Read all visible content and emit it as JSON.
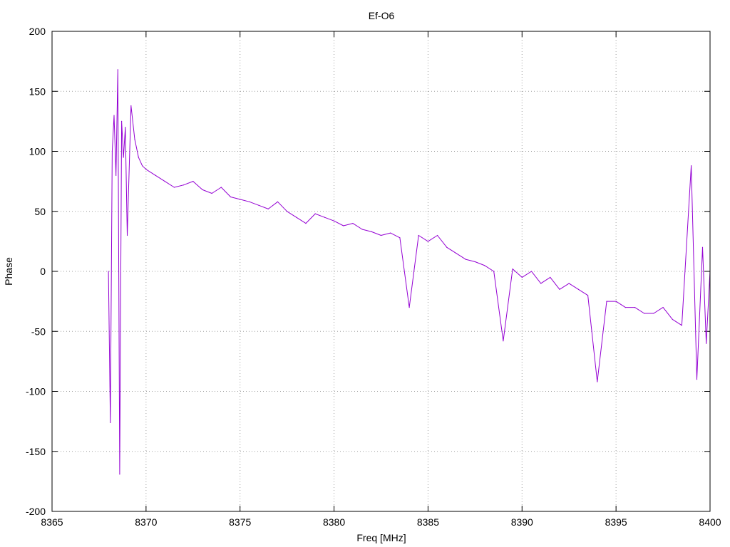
{
  "chart_data": {
    "type": "line",
    "title": "Ef-O6",
    "xlabel": "Freq [MHz]",
    "ylabel": "Phase",
    "xlim": [
      8365,
      8400
    ],
    "ylim": [
      -200,
      200
    ],
    "xticks": [
      8365,
      8370,
      8375,
      8380,
      8385,
      8390,
      8395,
      8400
    ],
    "yticks": [
      -200,
      -150,
      -100,
      -50,
      0,
      50,
      100,
      150,
      200
    ],
    "grid": true,
    "color": "#9400d3",
    "series": [
      {
        "x": [
          8368.0,
          8368.1,
          8368.2,
          8368.3,
          8368.4,
          8368.5,
          8368.6,
          8368.7,
          8368.8,
          8368.9,
          8369.0,
          8369.2,
          8369.4,
          8369.6,
          8369.8,
          8370.0,
          8370.5,
          8371.0,
          8371.5,
          8372.0,
          8372.5,
          8373.0,
          8373.5,
          8374.0,
          8374.5,
          8375.0,
          8375.5,
          8376.0,
          8376.5,
          8377.0,
          8377.5,
          8378.0,
          8378.5,
          8379.0,
          8379.5,
          8380.0,
          8380.5,
          8381.0,
          8381.5,
          8382.0,
          8382.5,
          8383.0,
          8383.5,
          8384.0,
          8384.5,
          8385.0,
          8385.5,
          8386.0,
          8386.5,
          8387.0,
          8387.5,
          8388.0,
          8388.5,
          8389.0,
          8389.5,
          8390.0,
          8390.5,
          8391.0,
          8391.5,
          8392.0,
          8392.5,
          8393.0,
          8393.5,
          8394.0,
          8394.5,
          8395.0,
          8395.5,
          8396.0,
          8396.5,
          8397.0,
          8397.5,
          8398.0,
          8398.5,
          8399.0,
          8399.3,
          8399.6,
          8399.8,
          8400.0
        ],
        "values": [
          0,
          -126,
          100,
          130,
          80,
          168,
          -169,
          125,
          95,
          120,
          30,
          138,
          110,
          95,
          88,
          85,
          80,
          75,
          70,
          72,
          75,
          68,
          65,
          70,
          62,
          60,
          58,
          55,
          52,
          58,
          50,
          45,
          40,
          48,
          45,
          42,
          38,
          40,
          35,
          33,
          30,
          32,
          28,
          -30,
          30,
          25,
          30,
          20,
          15,
          10,
          8,
          5,
          0,
          -58,
          2,
          -5,
          0,
          -10,
          -5,
          -15,
          -10,
          -15,
          -20,
          -92,
          -25,
          -25,
          -30,
          -30,
          -35,
          -35,
          -30,
          -40,
          -45,
          88,
          -90,
          20,
          -60,
          0
        ]
      }
    ]
  }
}
